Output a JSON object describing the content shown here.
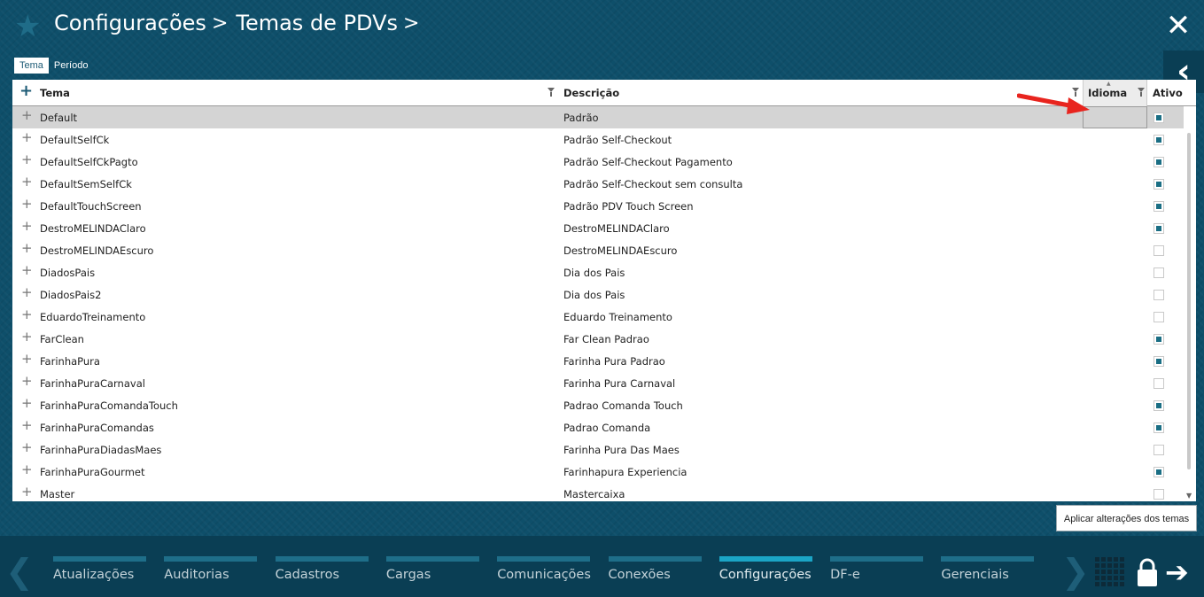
{
  "header": {
    "crumbs": [
      "Configurações",
      "Temas de PDVs"
    ],
    "sep": ">"
  },
  "tabs": [
    {
      "label": "Tema",
      "active": true
    },
    {
      "label": "Período",
      "active": false
    }
  ],
  "grid": {
    "columns": {
      "tema": "Tema",
      "descricao": "Descrição",
      "idioma": "Idioma",
      "ativo": "Ativo"
    },
    "rows": [
      {
        "tema": "Default",
        "descricao": "Padrão",
        "ativo": true,
        "selected": true
      },
      {
        "tema": "DefaultSelfCk",
        "descricao": "Padrão Self-Checkout",
        "ativo": true
      },
      {
        "tema": "DefaultSelfCkPagto",
        "descricao": "Padrão Self-Checkout Pagamento",
        "ativo": true
      },
      {
        "tema": "DefaultSemSelfCk",
        "descricao": "Padrão Self-Checkout sem consulta",
        "ativo": true
      },
      {
        "tema": "DefaultTouchScreen",
        "descricao": "Padrão PDV Touch Screen",
        "ativo": true
      },
      {
        "tema": "DestroMELINDAClaro",
        "descricao": "DestroMELINDAClaro",
        "ativo": true
      },
      {
        "tema": "DestroMELINDAEscuro",
        "descricao": "DestroMELINDAEscuro",
        "ativo": false
      },
      {
        "tema": "DiadosPais",
        "descricao": "Dia dos Pais",
        "ativo": false
      },
      {
        "tema": "DiadosPais2",
        "descricao": "Dia dos Pais",
        "ativo": false
      },
      {
        "tema": "EduardoTreinamento",
        "descricao": "Eduardo Treinamento",
        "ativo": false
      },
      {
        "tema": "FarClean",
        "descricao": "Far Clean Padrao",
        "ativo": true
      },
      {
        "tema": "FarinhaPura",
        "descricao": "Farinha Pura Padrao",
        "ativo": true
      },
      {
        "tema": "FarinhaPuraCarnaval",
        "descricao": "Farinha Pura Carnaval",
        "ativo": false
      },
      {
        "tema": "FarinhaPuraComandaTouch",
        "descricao": "Padrao Comanda Touch",
        "ativo": true
      },
      {
        "tema": "FarinhaPuraComandas",
        "descricao": "Padrao Comanda",
        "ativo": true
      },
      {
        "tema": "FarinhaPuraDiadasMaes",
        "descricao": "Farinha Pura Das Maes",
        "ativo": false
      },
      {
        "tema": "FarinhaPuraGourmet",
        "descricao": "Farinhapura Experiencia",
        "ativo": true
      },
      {
        "tema": "Master",
        "descricao": "Mastercaixa",
        "ativo": false
      }
    ]
  },
  "apply_button": "Aplicar alterações dos temas",
  "footer": {
    "menu": [
      {
        "label": "Atualizações",
        "active": false
      },
      {
        "label": "Auditorias",
        "active": false
      },
      {
        "label": "Cadastros",
        "active": false
      },
      {
        "label": "Cargas",
        "active": false
      },
      {
        "label": "Comunicações",
        "active": false
      },
      {
        "label": "Conexões",
        "active": false
      },
      {
        "label": "Configurações",
        "active": true
      },
      {
        "label": "DF-e",
        "active": false
      },
      {
        "label": "Gerenciais",
        "active": false
      }
    ]
  },
  "icons": {
    "star": "star-icon",
    "close": "close-icon",
    "collapse": "chevron-left-icon",
    "add": "plus-icon",
    "filter": "filter-icon",
    "apps": "grid-icon",
    "lock": "lock-icon",
    "exit": "exit-arrow-icon"
  },
  "colors": {
    "background": "#0e4f6a",
    "footer": "#0a3e54",
    "accent": "#1ba5c6",
    "checkbox": "#1a6e84",
    "selected_row": "#d4d4d4"
  }
}
